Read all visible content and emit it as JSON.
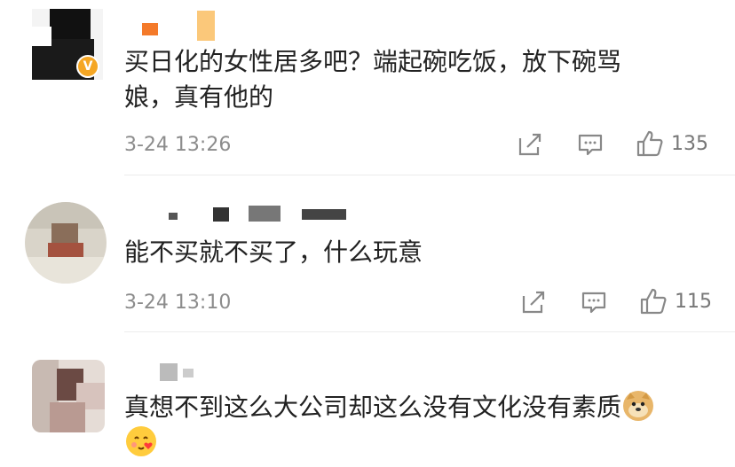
{
  "comments": [
    {
      "lines": [
        "买日化的女性居多吧？端起碗吃饭，放下碗骂",
        "娘，真有他的"
      ],
      "time": "3-24 13:26",
      "likes": "135",
      "verified_badge": "V"
    },
    {
      "lines": [
        "能不买就不买了，什么玩意"
      ],
      "time": "3-24 13:10",
      "likes": "115"
    },
    {
      "lines": [
        "真想不到这么大公司却这么没有文化没有素质"
      ]
    }
  ],
  "icons": {
    "share": "share-icon",
    "comment": "comment-icon",
    "like": "thumbs-up-icon",
    "doge": "doge-emoji",
    "heart_face": "heart-face-emoji"
  },
  "colors": {
    "badge": "#f5a623",
    "meta_text": "#8c8c8c",
    "divider": "#ececec"
  }
}
